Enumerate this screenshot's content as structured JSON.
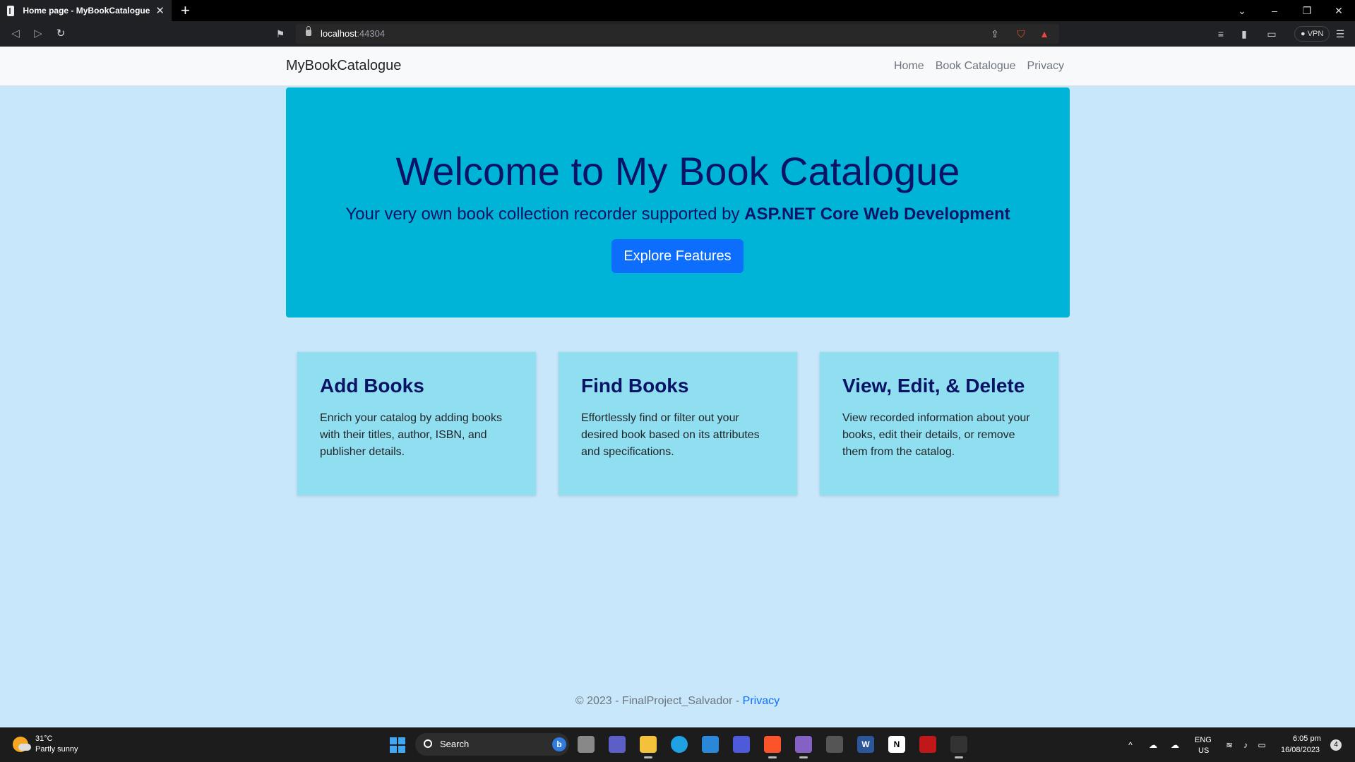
{
  "browser": {
    "tab_title": "Home page - MyBookCatalogue",
    "url_host": "localhost",
    "url_port": ":44304",
    "vpn_label": "VPN",
    "icons": [
      "back-icon",
      "forward-icon",
      "reload-icon",
      "bookmark-icon",
      "share-icon",
      "brave-shields-icon",
      "brave-rewards-icon",
      "playlist-icon",
      "sidebar-icon",
      "wallet-icon",
      "menu-icon"
    ]
  },
  "site": {
    "brand": "MyBookCatalogue",
    "nav": [
      "Home",
      "Book Catalogue",
      "Privacy"
    ]
  },
  "hero": {
    "title": "Welcome to My Book Catalogue",
    "lead_prefix": "Your very own book collection recorder supported by ",
    "lead_bold": "ASP.NET Core Web Development",
    "button": "Explore Features",
    "bg_color": "#00b4d8",
    "title_color": "#0b1366"
  },
  "features": [
    {
      "title": "Add Books",
      "text": "Enrich your catalog by adding books with their titles, author, ISBN, and publisher details."
    },
    {
      "title": "Find Books",
      "text": "Effortlessly find or filter out your desired book based on its attributes and specifications."
    },
    {
      "title": "View, Edit, & Delete",
      "text": "View recorded information about your books, edit their details, or remove them from the catalog."
    }
  ],
  "footer": {
    "text": "© 2023 - FinalProject_Salvador - ",
    "link": "Privacy"
  },
  "taskbar": {
    "weather_temp": "31°C",
    "weather_desc": "Partly sunny",
    "search_label": "Search",
    "lang_top": "ENG",
    "lang_bottom": "US",
    "time": "6:05 pm",
    "date": "16/08/2023",
    "notifications": "4"
  },
  "colors": {
    "page_bg": "#c8e7fb",
    "card_bg": "#90dff0",
    "primary": "#0d6efd"
  }
}
